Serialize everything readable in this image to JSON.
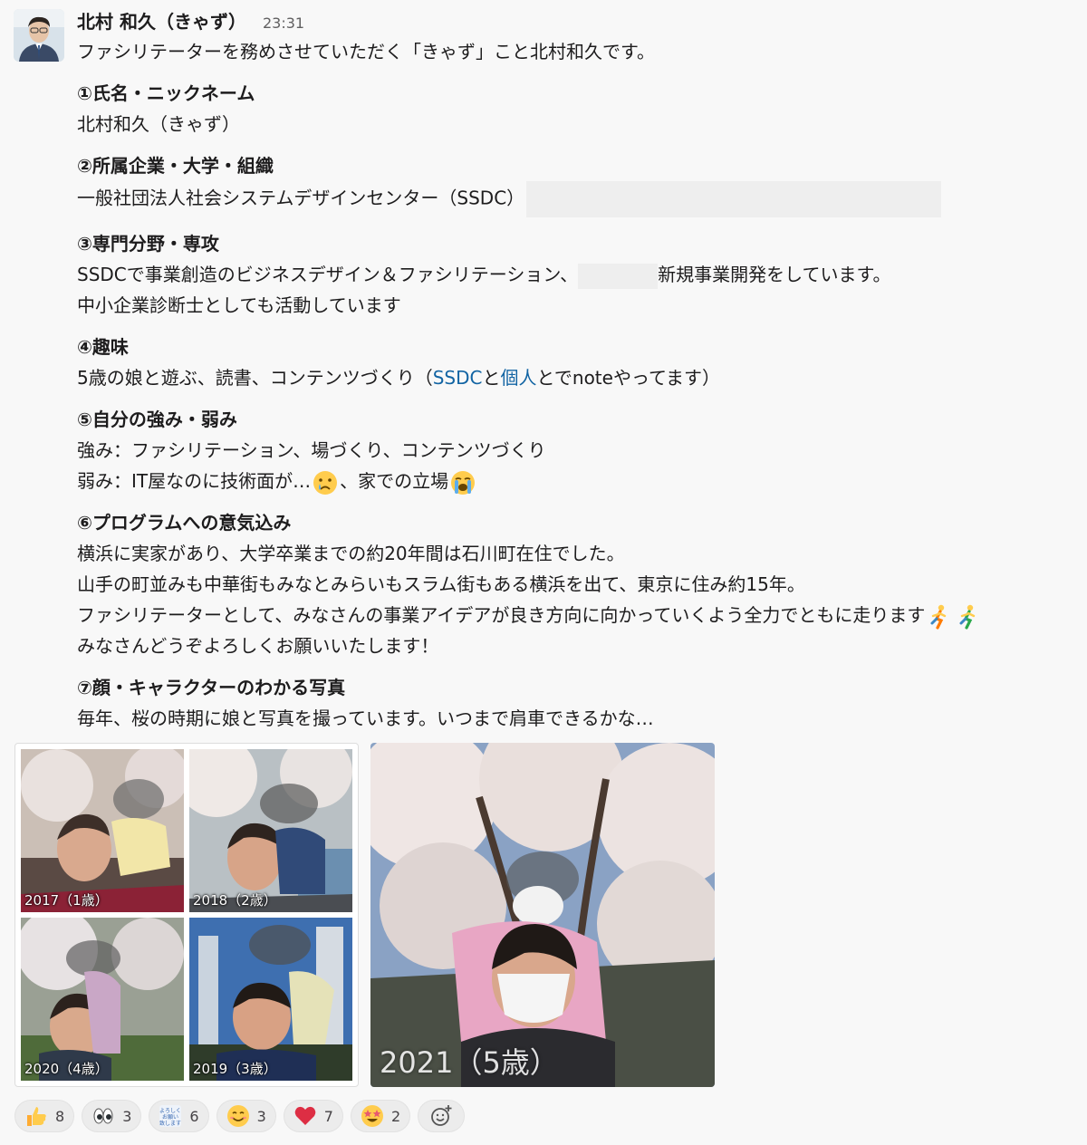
{
  "message": {
    "author": "北村 和久（きゃず）",
    "time": "23:31",
    "intro": "ファシリテーターを務めさせていただく「きゃず」こと北村和久です。",
    "s1_title": "①氏名・ニックネーム",
    "s1_text": "北村和久（きゃず）",
    "s2_title": "②所属企業・大学・組織",
    "s2_text": "一般社団法人社会システムデザインセンター（SSDC）",
    "s3_title": "③専門分野・専攻",
    "s3_text_a": "SSDCで事業創造のビジネスデザイン＆ファシリテーション、",
    "s3_text_b": "新規事業開発をしています。",
    "s3_text2": "中小企業診断士としても活動しています",
    "s4_title": "④趣味",
    "s4_text_a": "5歳の娘と遊ぶ、読書、コンテンツづくり（",
    "s4_link1": "SSDC",
    "s4_text_b": "と",
    "s4_link2": "個人",
    "s4_text_c": "とでnoteやってます）",
    "s5_title": "⑤自分の強み・弱み",
    "s5_text1": "強み：ファシリテーション、場づくり、コンテンツづくり",
    "s5_text2_a": "弱み：IT屋なのに技術面が…",
    "s5_text2_b": "、家での立場",
    "s6_title": "⑥プログラムへの意気込み",
    "s6_text1": "横浜に実家があり、大学卒業までの約20年間は石川町在住でした。",
    "s6_text2": "山手の町並みも中華街もみなとみらいもスラム街もある横浜を出て、東京に住み約15年。",
    "s6_text3": "ファシリテーターとして、みなさんの事業アイデアが良き方向に向かっていくよう全力でともに走ります",
    "s6_text4": "みなさんどうぞよろしくお願いいたします！",
    "s7_title": "⑦顔・キャラクターのわかる写真",
    "s7_text": "毎年、桜の時期に娘と写真を撮っています。いつまで肩車できるかな…"
  },
  "photos": {
    "c1": "2017（1歳）",
    "c2": "2018（2歳）",
    "c3": "2020（4歳）",
    "c4": "2019（3歳）",
    "big": "2021（5歳）"
  },
  "reactions": [
    {
      "icon": "thumbs-up-icon",
      "count": "8"
    },
    {
      "icon": "eyes-icon",
      "count": "3"
    },
    {
      "icon": "yoroshiku-onegaishimasu-icon",
      "label": "よろしくお願い致します",
      "count": "6"
    },
    {
      "icon": "smile-icon",
      "count": "3"
    },
    {
      "icon": "heart-icon",
      "count": "7"
    },
    {
      "icon": "star-struck-icon",
      "count": "2"
    }
  ],
  "colors": {
    "link": "#1264a3",
    "heart": "#dd2e44",
    "emoji_yellow": "#ffcc4d",
    "background": "#f8f8f8"
  }
}
